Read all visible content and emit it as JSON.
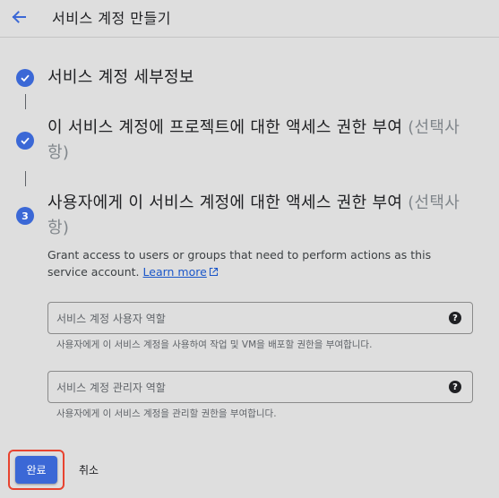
{
  "header": {
    "title": "서비스 계정 만들기"
  },
  "steps": [
    {
      "title": "서비스 계정 세부정보",
      "optional": "",
      "status": "completed"
    },
    {
      "title": "이 서비스 계정에 프로젝트에 대한 액세스 권한 부여 ",
      "optional": "(선택사항)",
      "status": "completed"
    },
    {
      "number": "3",
      "title": "사용자에게 이 서비스 계정에 대한 액세스 권한 부여 ",
      "optional": "(선택사항)",
      "status": "active"
    }
  ],
  "description": {
    "text": "Grant access to users or groups that need to perform actions as this service account.",
    "link": "Learn more"
  },
  "fields": [
    {
      "label": "서비스 계정 사용자 역할",
      "helper": "사용자에게 이 서비스 계정을 사용하여 작업 및 VM을 배포할 권한을 부여합니다."
    },
    {
      "label": "서비스 계정 관리자 역할",
      "helper": "사용자에게 이 서비스 계정을 관리할 권한을 부여합니다."
    }
  ],
  "actions": {
    "done": "완료",
    "cancel": "취소"
  },
  "colors": {
    "accent": "#3b68d6",
    "focus_outline": "#e8432f",
    "link": "#1a56c9"
  },
  "icons": [
    "back-arrow-icon",
    "check-icon",
    "external-link-icon",
    "help-icon"
  ]
}
